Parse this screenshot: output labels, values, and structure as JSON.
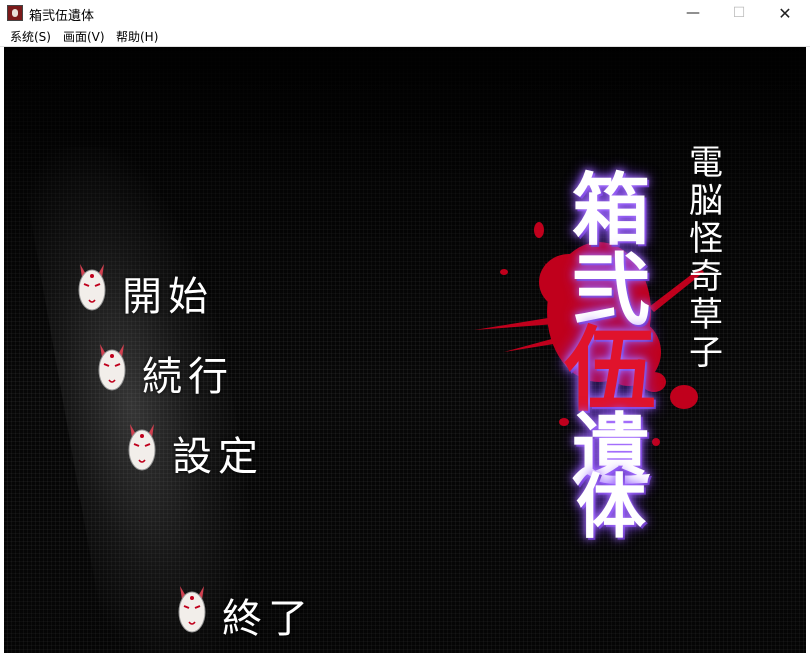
{
  "window": {
    "title": "箱弐伍遺体",
    "controls": {
      "minimize": "—",
      "maximize": "☐",
      "close": "✕"
    }
  },
  "menubar": {
    "items": [
      {
        "label": "系统(S)"
      },
      {
        "label": "画面(V)"
      },
      {
        "label": "帮助(H)"
      }
    ]
  },
  "title_screen": {
    "logo": {
      "main_chars": [
        "箱",
        "弐",
        "伍",
        "遺",
        "体"
      ],
      "subtitle": "電脳怪奇草子"
    },
    "menu": [
      {
        "label": "開始"
      },
      {
        "label": "続行"
      },
      {
        "label": "設定"
      },
      {
        "label": "終了"
      }
    ]
  },
  "colors": {
    "background": "#080808",
    "blood": "#c0001c",
    "glow": "#8a4cff",
    "menu_text": "#ffffff"
  },
  "icons": {
    "menu_cursor": "kitsune-mask-icon",
    "app": "app-icon"
  }
}
